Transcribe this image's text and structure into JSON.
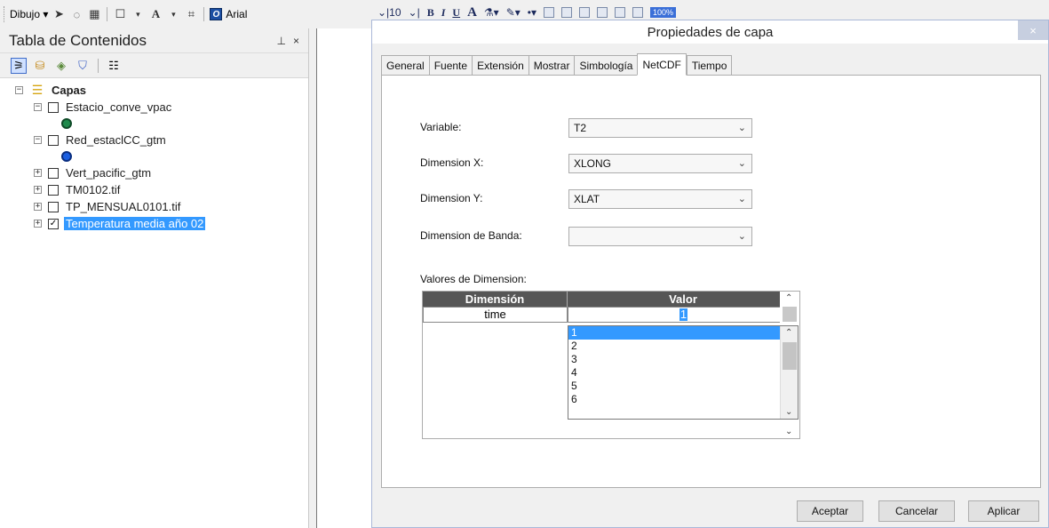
{
  "draw_toolbar": {
    "draw_label": "Dibujo",
    "font_name": "Arial"
  },
  "format_toolbar": {
    "font_size": "10",
    "bold": "B",
    "italic": "I",
    "underline": "U",
    "font_color_letter": "A",
    "zoom_label": "100%"
  },
  "toc": {
    "title": "Tabla de Contenidos",
    "pin": "\u0001",
    "close": "×",
    "root_label": "Capas",
    "layers": [
      {
        "name": "Estacio_conve_vpac",
        "checked": false,
        "symbol_color": "#1f8a4c"
      },
      {
        "name": "Red_estaclCC_gtm",
        "checked": false,
        "symbol_color": "#1c5fe0"
      },
      {
        "name": "Vert_pacific_gtm",
        "checked": false
      },
      {
        "name": "TM0102.tif",
        "checked": false
      },
      {
        "name": "TP_MENSUAL0101.tif",
        "checked": false
      },
      {
        "name": "Temperatura media año 02",
        "checked": true,
        "selected": true
      }
    ]
  },
  "dialog": {
    "title": "Propiedades de capa",
    "close": "×",
    "tabs": [
      "General",
      "Fuente",
      "Extensión",
      "Mostrar",
      "Simbología",
      "NetCDF",
      "Tiempo"
    ],
    "active_tab": "NetCDF",
    "fields": {
      "variable_label": "Variable:",
      "variable_value": "T2",
      "dim_x_label": "Dimension X:",
      "dim_x_value": "XLONG",
      "dim_y_label": "Dimension Y:",
      "dim_y_value": "XLAT",
      "band_label": "Dimension de Banda:",
      "band_value": ""
    },
    "dimension_values_label": "Valores de Dimension:",
    "grid": {
      "headers": [
        "Dimensión",
        "Valor"
      ],
      "rows": [
        {
          "dimension": "time",
          "value": "1"
        }
      ]
    },
    "dropdown_options": [
      "1",
      "2",
      "3",
      "4",
      "5",
      "6"
    ],
    "dropdown_selected": "1",
    "buttons": {
      "ok": "Aceptar",
      "cancel": "Cancelar",
      "apply": "Aplicar"
    }
  },
  "colors": {
    "selection": "#3399ff",
    "grid_header": "#565656"
  }
}
